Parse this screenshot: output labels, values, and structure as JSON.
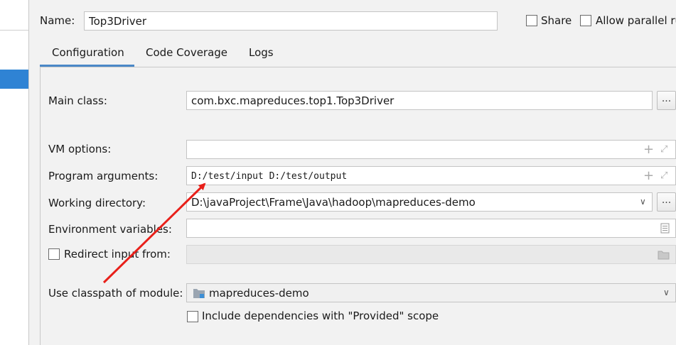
{
  "header": {
    "name_label": "Name:",
    "name_value": "Top3Driver",
    "share_label": "Share",
    "allow_parallel_label": "Allow parallel ru"
  },
  "tabs": [
    {
      "label": "Configuration",
      "active": true
    },
    {
      "label": "Code Coverage",
      "active": false
    },
    {
      "label": "Logs",
      "active": false
    }
  ],
  "form": {
    "main_class_label": "Main class:",
    "main_class_value": "com.bxc.mapreduces.top1.Top3Driver",
    "browse_label": "...",
    "vm_options_label": "VM options:",
    "vm_options_value": "",
    "program_args_label": "Program arguments:",
    "program_args_value": "D:/test/input D:/test/output",
    "working_dir_label": "Working directory:",
    "working_dir_value": "D:\\javaProject\\Frame\\Java\\hadoop\\mapreduces-demo",
    "env_vars_label": "Environment variables:",
    "env_vars_value": "",
    "redirect_input_label": "Redirect input from:",
    "classpath_label": "Use classpath of module:",
    "classpath_value": "mapreduces-demo",
    "include_deps_label": "Include dependencies with \"Provided\" scope"
  },
  "colors": {
    "accent": "#4a88c7",
    "selection": "#2f83d4",
    "annotation_arrow": "#e8201a"
  }
}
